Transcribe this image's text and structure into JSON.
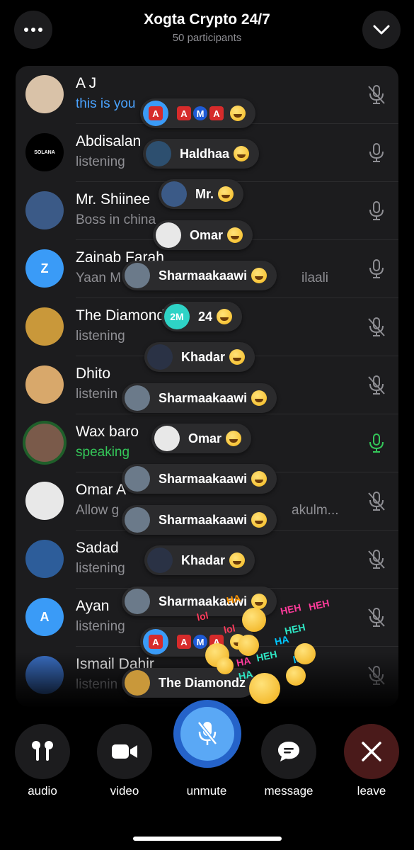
{
  "header": {
    "title": "Xogta Crypto 24/7",
    "subtitle": "50 participants"
  },
  "participants": [
    {
      "name": "A J",
      "status": "this is you",
      "status_color": "#4aa3ff",
      "mic": "muted",
      "avatar_bg": "#d9c2a8",
      "avatar_icon": "baby-photo"
    },
    {
      "name": "Abdisalan",
      "status": "listening",
      "status_color": "#8e8e93",
      "mic": "on",
      "avatar_bg": "#000000",
      "avatar_icon": "solana-logo",
      "avatar_text": "SOLANA"
    },
    {
      "name": "Mr. Shiinee",
      "status": "Boss in china",
      "status_color": "#8e8e93",
      "mic": "on",
      "avatar_bg": "#3b5a87",
      "avatar_icon": "building-photo"
    },
    {
      "name": "Zainab Farah",
      "status": "Yaan M",
      "status_tail": "ilaali",
      "status_color": "#8e8e93",
      "mic": "on",
      "avatar_bg": "#3a9bf7",
      "avatar_text": "Z"
    },
    {
      "name": "The Diamond",
      "status": "listening",
      "status_color": "#8e8e93",
      "mic": "muted",
      "avatar_bg": "#c9983a",
      "avatar_icon": "hamster-photo"
    },
    {
      "name": "Dhito",
      "status": "listenin",
      "status_color": "#8e8e93",
      "mic": "muted",
      "avatar_bg": "#d8a86b",
      "avatar_icon": "food-photo"
    },
    {
      "name": "Wax baro",
      "status": "speaking",
      "status_color": "#34c759",
      "mic": "speaking",
      "avatar_bg": "#7a5a4a",
      "avatar_icon": "money-photo"
    },
    {
      "name": "Omar A",
      "status": "Allow g",
      "status_tail": "akulm...",
      "status_color": "#8e8e93",
      "mic": "muted",
      "avatar_bg": "#e8e8e8",
      "avatar_icon": "chart-photo"
    },
    {
      "name": "Sadad",
      "status": "listening",
      "status_color": "#8e8e93",
      "mic": "muted",
      "avatar_bg": "#2d5d9a",
      "avatar_icon": "trading-desk-photo"
    },
    {
      "name": "Ayan",
      "status": "listening",
      "status_color": "#8e8e93",
      "mic": "muted",
      "avatar_bg": "#3a9bf7",
      "avatar_text": "A"
    },
    {
      "name": "Ismail Dahir",
      "status": "listenin",
      "status_color": "#8e8e93",
      "mic": "muted",
      "avatar_bg": "#3a6fc4",
      "avatar_icon": "star-flag"
    }
  ],
  "reactions": [
    {
      "label": "",
      "emoji_row": [
        "A",
        "A",
        "M",
        "A"
      ],
      "avatar_bg": "#3a9bf7",
      "avatar_icon": "ama-icon"
    },
    {
      "label": "Haldhaa",
      "avatar_bg": "#2d4f6f",
      "avatar_icon": "city-photo"
    },
    {
      "label": "Mr.",
      "avatar_bg": "#3b5a87",
      "avatar_icon": "building-photo"
    },
    {
      "label": "Omar",
      "avatar_bg": "#e8e8e8",
      "avatar_icon": "chart-photo",
      "emoji": "shocked"
    },
    {
      "label": "Sharmaakaawi",
      "avatar_bg": "#6b7a8a",
      "avatar_icon": "sunset-photo"
    },
    {
      "label": "24",
      "avatar_bg": "#2ed3c6",
      "avatar_text": "2M"
    },
    {
      "label": "Khadar",
      "avatar_bg": "#2a3245",
      "avatar_icon": "man-photo"
    },
    {
      "label": "Sharmaakaawi",
      "avatar_bg": "#6b7a8a",
      "avatar_icon": "sunset-photo"
    },
    {
      "label": "Omar",
      "avatar_bg": "#e8e8e8",
      "avatar_icon": "chart-photo",
      "emoji": "shocked"
    },
    {
      "label": "Sharmaakaawi",
      "avatar_bg": "#6b7a8a",
      "avatar_icon": "sunset-photo"
    },
    {
      "label": "Sharmaakaawi",
      "avatar_bg": "#6b7a8a",
      "avatar_icon": "sunset-photo"
    },
    {
      "label": "Khadar",
      "avatar_bg": "#2a3245",
      "avatar_icon": "man-photo"
    },
    {
      "label": "Sharmaakaawi",
      "avatar_bg": "#6b7a8a",
      "avatar_icon": "sunset-photo"
    },
    {
      "label": "",
      "emoji_row": [
        "A",
        "A",
        "M",
        "A"
      ],
      "avatar_bg": "#3a9bf7",
      "avatar_icon": "ama-icon"
    },
    {
      "label": "The Diamondz",
      "avatar_bg": "#c9983a",
      "avatar_icon": "hamster-photo"
    }
  ],
  "floating_texts": [
    "lol",
    "lol",
    "HA",
    "HEH",
    "HEH",
    "HEH",
    "HA",
    "HEH",
    "HA",
    "lol",
    "HA"
  ],
  "controls": {
    "audio_label": "audio",
    "video_label": "video",
    "unmute_label": "unmute",
    "message_label": "message",
    "leave_label": "leave"
  },
  "colors": {
    "accent_blue": "#3a9bf7",
    "speaking_green": "#34c759",
    "leave_red": "#4a1a1a",
    "panel_bg": "#1c1c1e"
  }
}
